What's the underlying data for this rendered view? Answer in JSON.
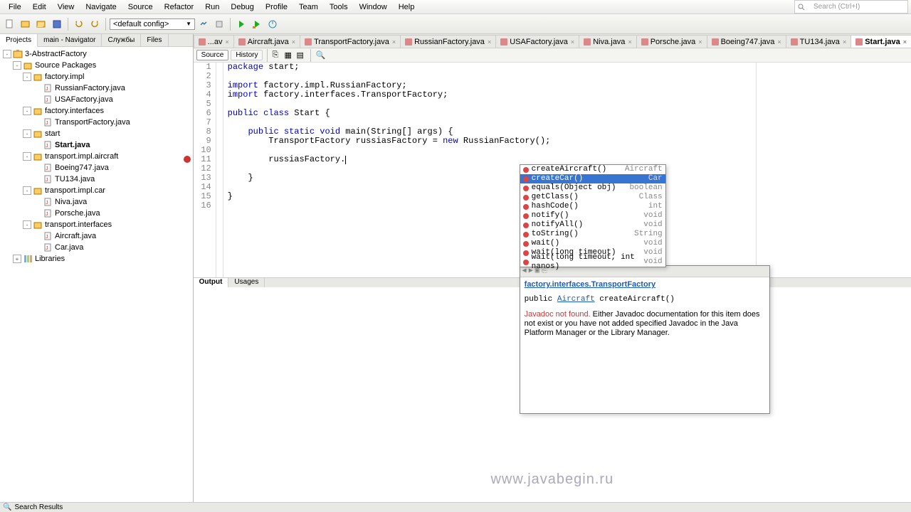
{
  "menu": {
    "items": [
      "File",
      "Edit",
      "View",
      "Navigate",
      "Source",
      "Refactor",
      "Run",
      "Debug",
      "Profile",
      "Team",
      "Tools",
      "Window",
      "Help"
    ]
  },
  "search": {
    "placeholder": "Search (Ctrl+I)"
  },
  "toolbar": {
    "config": "<default config>"
  },
  "side_tabs": [
    "Projects",
    "main - Navigator",
    "Службы",
    "Files"
  ],
  "tree": [
    {
      "indent": 0,
      "tw": "-",
      "icon": "proj",
      "label": "3-AbstractFactory",
      "bold": false
    },
    {
      "indent": 1,
      "tw": "-",
      "icon": "pkg",
      "label": "Source Packages",
      "bold": false
    },
    {
      "indent": 2,
      "tw": "-",
      "icon": "folder",
      "label": "factory.impl",
      "bold": false
    },
    {
      "indent": 3,
      "tw": "",
      "icon": "java",
      "label": "RussianFactory.java",
      "bold": false
    },
    {
      "indent": 3,
      "tw": "",
      "icon": "java",
      "label": "USAFactory.java",
      "bold": false
    },
    {
      "indent": 2,
      "tw": "-",
      "icon": "folder",
      "label": "factory.interfaces",
      "bold": false
    },
    {
      "indent": 3,
      "tw": "",
      "icon": "java",
      "label": "TransportFactory.java",
      "bold": false
    },
    {
      "indent": 2,
      "tw": "-",
      "icon": "folder",
      "label": "start",
      "bold": false
    },
    {
      "indent": 3,
      "tw": "",
      "icon": "java",
      "label": "Start.java",
      "bold": true
    },
    {
      "indent": 2,
      "tw": "-",
      "icon": "folder",
      "label": "transport.impl.aircraft",
      "bold": false
    },
    {
      "indent": 3,
      "tw": "",
      "icon": "java",
      "label": "Boeing747.java",
      "bold": false
    },
    {
      "indent": 3,
      "tw": "",
      "icon": "java",
      "label": "TU134.java",
      "bold": false
    },
    {
      "indent": 2,
      "tw": "-",
      "icon": "folder",
      "label": "transport.impl.car",
      "bold": false
    },
    {
      "indent": 3,
      "tw": "",
      "icon": "java",
      "label": "Niva.java",
      "bold": false
    },
    {
      "indent": 3,
      "tw": "",
      "icon": "java",
      "label": "Porsche.java",
      "bold": false
    },
    {
      "indent": 2,
      "tw": "-",
      "icon": "folder",
      "label": "transport.interfaces",
      "bold": false
    },
    {
      "indent": 3,
      "tw": "",
      "icon": "java",
      "label": "Aircraft.java",
      "bold": false
    },
    {
      "indent": 3,
      "tw": "",
      "icon": "java",
      "label": "Car.java",
      "bold": false
    },
    {
      "indent": 1,
      "tw": "+",
      "icon": "lib",
      "label": "Libraries",
      "bold": false
    }
  ],
  "file_tabs": [
    {
      "label": "...av",
      "active": false
    },
    {
      "label": "Aircraft.java",
      "active": false
    },
    {
      "label": "TransportFactory.java",
      "active": false
    },
    {
      "label": "RussianFactory.java",
      "active": false
    },
    {
      "label": "USAFactory.java",
      "active": false
    },
    {
      "label": "Niva.java",
      "active": false
    },
    {
      "label": "Porsche.java",
      "active": false
    },
    {
      "label": "Boeing747.java",
      "active": false
    },
    {
      "label": "TU134.java",
      "active": false
    },
    {
      "label": "Start.java",
      "active": true
    }
  ],
  "editor_tb": {
    "source": "Source",
    "history": "History"
  },
  "code": {
    "lines": [
      {
        "n": 1
      },
      {
        "n": 2
      },
      {
        "n": 3
      },
      {
        "n": 4
      },
      {
        "n": 5
      },
      {
        "n": 6
      },
      {
        "n": 7
      },
      {
        "n": 8
      },
      {
        "n": 9
      },
      {
        "n": 10
      },
      {
        "n": 11,
        "err": true
      },
      {
        "n": 12
      },
      {
        "n": 13
      },
      {
        "n": 14
      },
      {
        "n": 15
      },
      {
        "n": 16
      }
    ]
  },
  "autocomplete": [
    {
      "name": "createAircraft()",
      "ret": "Aircraft",
      "sel": false
    },
    {
      "name": "createCar()",
      "ret": "Car",
      "sel": true
    },
    {
      "name": "equals(Object obj)",
      "ret": "boolean",
      "sel": false,
      "param": "obj"
    },
    {
      "name": "getClass()",
      "ret": "Class<?>",
      "sel": false
    },
    {
      "name": "hashCode()",
      "ret": "int",
      "sel": false
    },
    {
      "name": "notify()",
      "ret": "void",
      "sel": false
    },
    {
      "name": "notifyAll()",
      "ret": "void",
      "sel": false
    },
    {
      "name": "toString()",
      "ret": "String",
      "sel": false
    },
    {
      "name": "wait()",
      "ret": "void",
      "sel": false
    },
    {
      "name": "wait(long timeout)",
      "ret": "void",
      "sel": false,
      "param": "timeout"
    },
    {
      "name": "wait(long timeout, int nanos)",
      "ret": "void",
      "sel": false,
      "param": "timeout nanos"
    }
  ],
  "javadoc": {
    "link": "factory.interfaces.TransportFactory",
    "sig_prefix": "public ",
    "sig_type": "Aircraft",
    "sig_suffix": " createAircraft()",
    "notfound": "Javadoc not found.",
    "text": " Either Javadoc documentation for this item does not exist or you have not added specified Javadoc in the Java Platform Manager or the Library Manager."
  },
  "bottom_tabs": [
    "Output",
    "Usages"
  ],
  "statusbar": {
    "text": "Search Results"
  },
  "watermark": "www.javabegin.ru"
}
